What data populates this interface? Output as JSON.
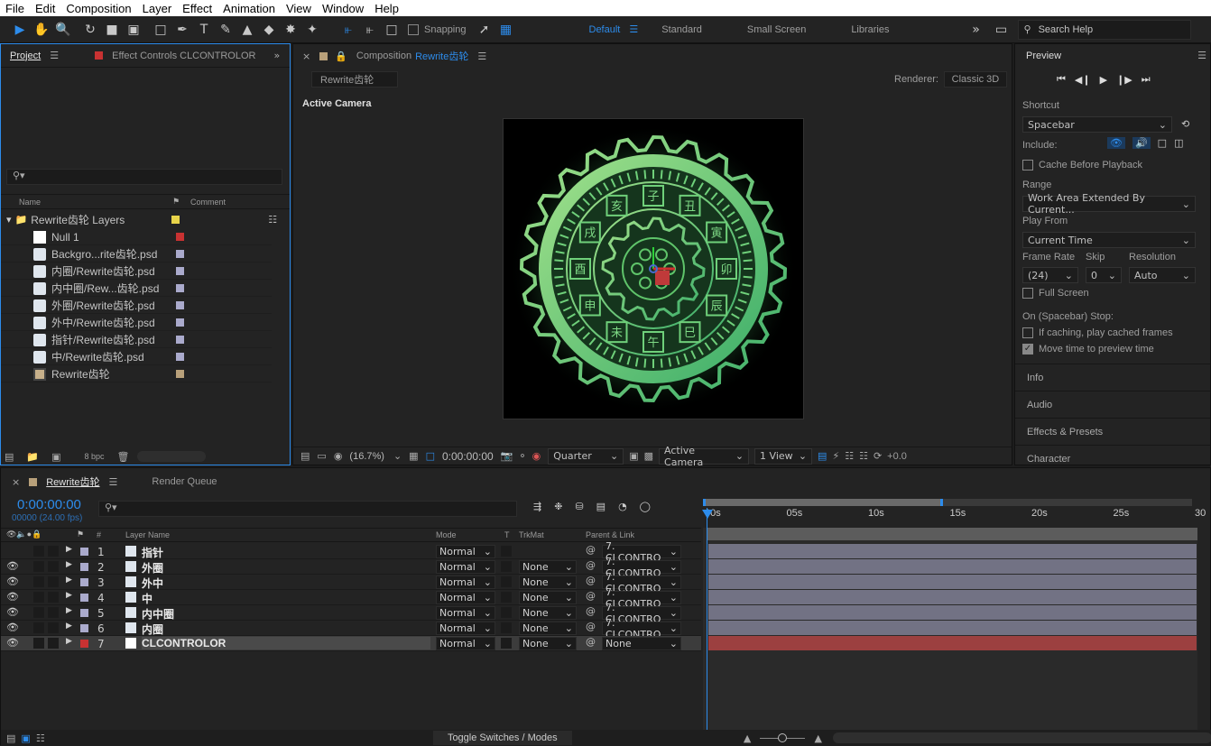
{
  "menu": [
    "File",
    "Edit",
    "Composition",
    "Layer",
    "Effect",
    "Animation",
    "View",
    "Window",
    "Help"
  ],
  "toolbar": {
    "snapping": "Snapping",
    "workspaces": [
      "Default",
      "Standard",
      "Small Screen",
      "Libraries"
    ],
    "search_placeholder": "Search Help"
  },
  "project": {
    "tab_project": "Project",
    "tab_effect": "Effect Controls CLCONTROLOR",
    "col_name": "Name",
    "col_comment": "Comment",
    "folder": "Rewrite齿轮 Layers",
    "items": [
      {
        "name": "Null 1",
        "color": "#c83232",
        "icon": "solid"
      },
      {
        "name": "Backgro...rite齿轮.psd",
        "color": "#aaaacc",
        "icon": "psd"
      },
      {
        "name": "内圈/Rewrite齿轮.psd",
        "color": "#aaaacc",
        "icon": "psd"
      },
      {
        "name": "内中圈/Rew...齿轮.psd",
        "color": "#aaaacc",
        "icon": "psd"
      },
      {
        "name": "外圈/Rewrite齿轮.psd",
        "color": "#aaaacc",
        "icon": "psd"
      },
      {
        "name": "外中/Rewrite齿轮.psd",
        "color": "#aaaacc",
        "icon": "psd"
      },
      {
        "name": "指针/Rewrite齿轮.psd",
        "color": "#aaaacc",
        "icon": "psd"
      },
      {
        "name": "中/Rewrite齿轮.psd",
        "color": "#aaaacc",
        "icon": "psd"
      },
      {
        "name": "Rewrite齿轮",
        "color": "#b8a07a",
        "icon": "comp"
      }
    ],
    "bpc": "8 bpc"
  },
  "composition": {
    "tab_prefix": "Composition",
    "tab_name": "Rewrite齿轮",
    "subtab": "Rewrite齿轮",
    "renderer_label": "Renderer:",
    "renderer": "Classic 3D",
    "camera_label": "Active Camera",
    "zoom": "(16.7%)",
    "time": "0:00:00:00",
    "resolution": "Quarter",
    "view_camera": "Active Camera",
    "views": "1 View",
    "exposure": "+0.0",
    "dial_chars": [
      "子",
      "丑",
      "寅",
      "卯",
      "辰",
      "巳",
      "午",
      "未",
      "申",
      "酉",
      "戌",
      "亥"
    ]
  },
  "preview": {
    "title": "Preview",
    "shortcut_label": "Shortcut",
    "shortcut": "Spacebar",
    "include_label": "Include:",
    "cache_before": "Cache Before Playback",
    "range_label": "Range",
    "range": "Work Area Extended By Current...",
    "play_from_label": "Play From",
    "play_from": "Current Time",
    "frame_rate_label": "Frame Rate",
    "skip_label": "Skip",
    "resolution_label": "Resolution",
    "frame_rate": "(24)",
    "skip": "0",
    "resolution": "Auto",
    "full_screen": "Full Screen",
    "on_stop": "On (Spacebar) Stop:",
    "if_caching": "If caching, play cached frames",
    "move_time": "Move time to preview time",
    "move_time_checked": true
  },
  "side_panels": [
    "Info",
    "Audio",
    "Effects & Presets",
    "Character"
  ],
  "timeline": {
    "tab_comp": "Rewrite齿轮",
    "tab_render": "Render Queue",
    "timecode": "0:00:00:00",
    "frames": "00000 (24.00 fps)",
    "col_layer": "Layer Name",
    "col_mode": "Mode",
    "col_t": "T",
    "col_trkmat": "TrkMat",
    "col_parent": "Parent & Link",
    "col_num": "#",
    "ruler": [
      "00s",
      "05s",
      "10s",
      "15s",
      "20s",
      "25s",
      "30"
    ],
    "layers": [
      {
        "num": "1",
        "name": "指针",
        "mode": "Normal",
        "trk": "",
        "parent": "7. CLCONTRO",
        "color": "#aaaacc",
        "eye": false
      },
      {
        "num": "2",
        "name": "外圈",
        "mode": "Normal",
        "trk": "None",
        "parent": "7. CLCONTRO",
        "color": "#aaaacc",
        "eye": true
      },
      {
        "num": "3",
        "name": "外中",
        "mode": "Normal",
        "trk": "None",
        "parent": "7. CLCONTRO",
        "color": "#aaaacc",
        "eye": true
      },
      {
        "num": "4",
        "name": "中",
        "mode": "Normal",
        "trk": "None",
        "parent": "7. CLCONTRO",
        "color": "#aaaacc",
        "eye": true
      },
      {
        "num": "5",
        "name": "内中圈",
        "mode": "Normal",
        "trk": "None",
        "parent": "7. CLCONTRO",
        "color": "#aaaacc",
        "eye": true
      },
      {
        "num": "6",
        "name": "内圈",
        "mode": "Normal",
        "trk": "None",
        "parent": "7. CLCONTRO",
        "color": "#aaaacc",
        "eye": true
      },
      {
        "num": "7",
        "name": "CLCONTROLOR",
        "mode": "Normal",
        "trk": "None",
        "parent": "None",
        "color": "#c83232",
        "eye": true
      }
    ],
    "toggle": "Toggle Switches / Modes"
  },
  "colors": {
    "accent": "#2d8ceb",
    "bg": "#232323",
    "track": "#a3a3c2",
    "null_track": "#b04444",
    "gear": "#5fc46a"
  }
}
